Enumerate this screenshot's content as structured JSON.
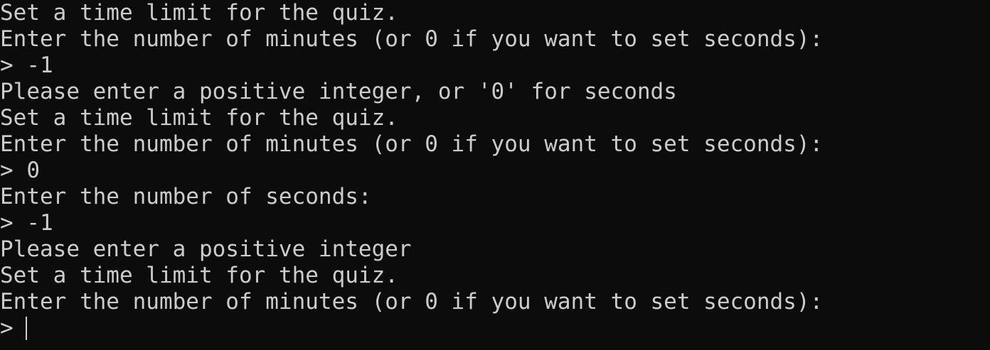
{
  "terminal": {
    "colors": {
      "background": "#0c0c0c",
      "foreground": "#cccccc"
    },
    "lines": [
      "Set a time limit for the quiz.",
      "Enter the number of minutes (or 0 if you want to set seconds):",
      "> -1",
      "Please enter a positive integer, or '0' for seconds",
      "Set a time limit for the quiz.",
      "Enter the number of minutes (or 0 if you want to set seconds):",
      "> 0",
      "Enter the number of seconds:",
      "> -1",
      "Please enter a positive integer",
      "Set a time limit for the quiz.",
      "Enter the number of minutes (or 0 if you want to set seconds):"
    ],
    "prompt": ">"
  }
}
